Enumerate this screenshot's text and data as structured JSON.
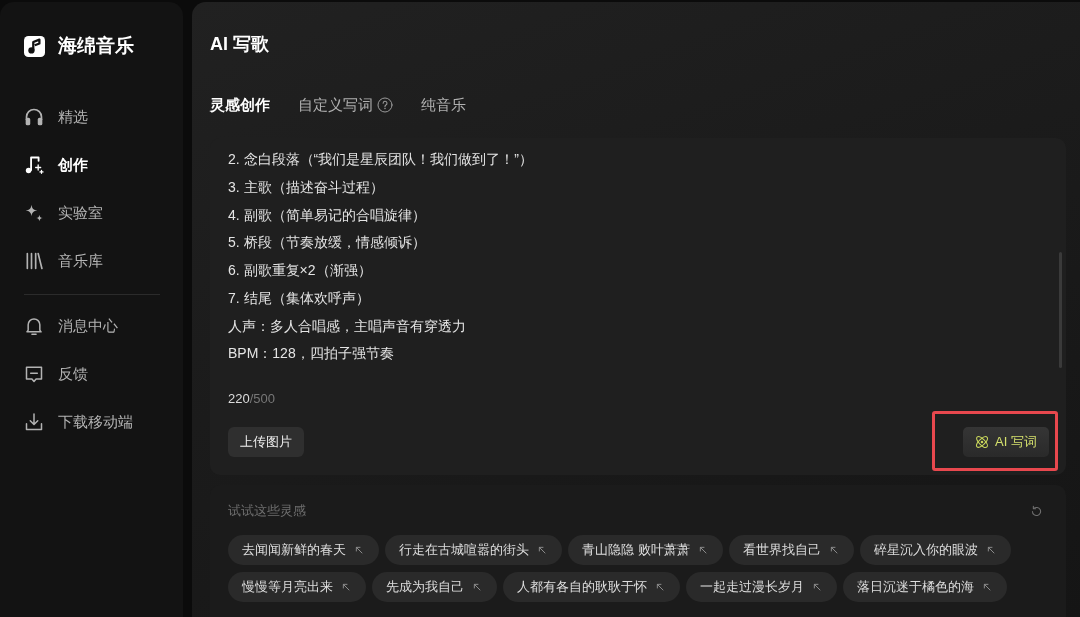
{
  "sidebar": {
    "brand": "海绵音乐",
    "nav_items": [
      {
        "label": "精选",
        "selected": false
      },
      {
        "label": "创作",
        "selected": true
      },
      {
        "label": "实验室",
        "selected": false
      },
      {
        "label": "音乐库",
        "selected": false
      }
    ],
    "bottom_items": [
      {
        "label": "消息中心",
        "selected": false
      },
      {
        "label": "反馈",
        "selected": false
      },
      {
        "label": "下载移动端",
        "selected": false
      }
    ]
  },
  "page_title": "AI 写歌",
  "tabs": [
    {
      "label": "灵感创作",
      "selected": true,
      "help": false
    },
    {
      "label": "自定义写词",
      "selected": false,
      "help": true
    },
    {
      "label": "纯音乐",
      "selected": false,
      "help": false
    }
  ],
  "prompt": {
    "lines": [
      "2. 念白段落（“我们是星辰团队！我们做到了！”）",
      "3. 主歌（描述奋斗过程）",
      "4. 副歌（简单易记的合唱旋律）",
      "5. 桥段（节奏放缓，情感倾诉）",
      "6. 副歌重复×2（渐强）",
      "7. 结尾（集体欢呼声）",
      "人声：多人合唱感，主唱声音有穿透力",
      "BPM：128，四拍子强节奏"
    ],
    "count": "220",
    "limit": "/500",
    "upload_button": "上传图片",
    "ai_button": {
      "label": "AI 写词",
      "highlighted": true
    }
  },
  "suggestions": {
    "title": "试试这些灵感",
    "rows": [
      [
        "去闻闻新鲜的春天",
        "行走在古城喧嚣的街头",
        "青山隐隐 败叶萧萧",
        "看世界找自己",
        "碎星沉入你的眼波"
      ],
      [
        "慢慢等月亮出来",
        "先成为我自己",
        "人都有各自的耿耿于怀",
        "一起走过漫长岁月",
        "落日沉迷于橘色的海"
      ]
    ]
  }
}
